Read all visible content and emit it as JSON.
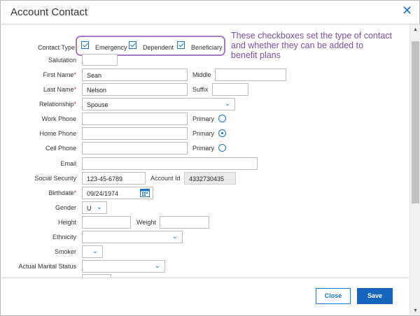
{
  "dialog": {
    "title": "Account Contact",
    "close_icon": "close-icon"
  },
  "callout": {
    "text": "These checkboxes set the type of contact and whether they can be added to benefit  plans"
  },
  "form": {
    "contact_type_label": "Contact Type",
    "contact_types": [
      {
        "label": "Emergency",
        "checked": true
      },
      {
        "label": "Dependent",
        "checked": true
      },
      {
        "label": "Beneficiary",
        "checked": true
      }
    ],
    "salutation_label": "Salutation",
    "salutation_value": "",
    "first_name_label": "First Name",
    "first_name_value": "Sean",
    "middle_label": "Middle",
    "middle_value": "",
    "last_name_label": "Last Name",
    "last_name_value": "Nelson",
    "suffix_label": "Suffix",
    "suffix_value": "",
    "relationship_label": "Relationship",
    "relationship_value": "Spouse",
    "work_phone_label": "Work Phone",
    "work_phone_value": "",
    "home_phone_label": "Home Phone",
    "home_phone_value": "",
    "cell_phone_label": "Cell Phone",
    "cell_phone_value": "",
    "primary_label": "Primary",
    "primary_selected": "home_phone",
    "email_label": "Email",
    "email_value": "",
    "ssn_label": "Social Security",
    "ssn_value": "123-45-6789",
    "account_id_label": "Account Id",
    "account_id_value": "4332730435",
    "birthdate_label": "Birthdate",
    "birthdate_value": "09/24/1974",
    "gender_label": "Gender",
    "gender_value": "U",
    "height_label": "Height",
    "height_value": "",
    "weight_label": "Weight",
    "weight_value": "",
    "ethnicity_label": "Ethnicity",
    "ethnicity_value": "",
    "smoker_label": "Smoker",
    "smoker_value": "",
    "marital_label": "Actual Marital Status",
    "marital_value": "",
    "required_mark": "*"
  },
  "footer": {
    "close_label": "Close",
    "save_label": "Save"
  },
  "colors": {
    "accent": "#1976d2",
    "save_bg": "#1565c0",
    "callout": "#a67bc6",
    "required": "#c62828"
  }
}
